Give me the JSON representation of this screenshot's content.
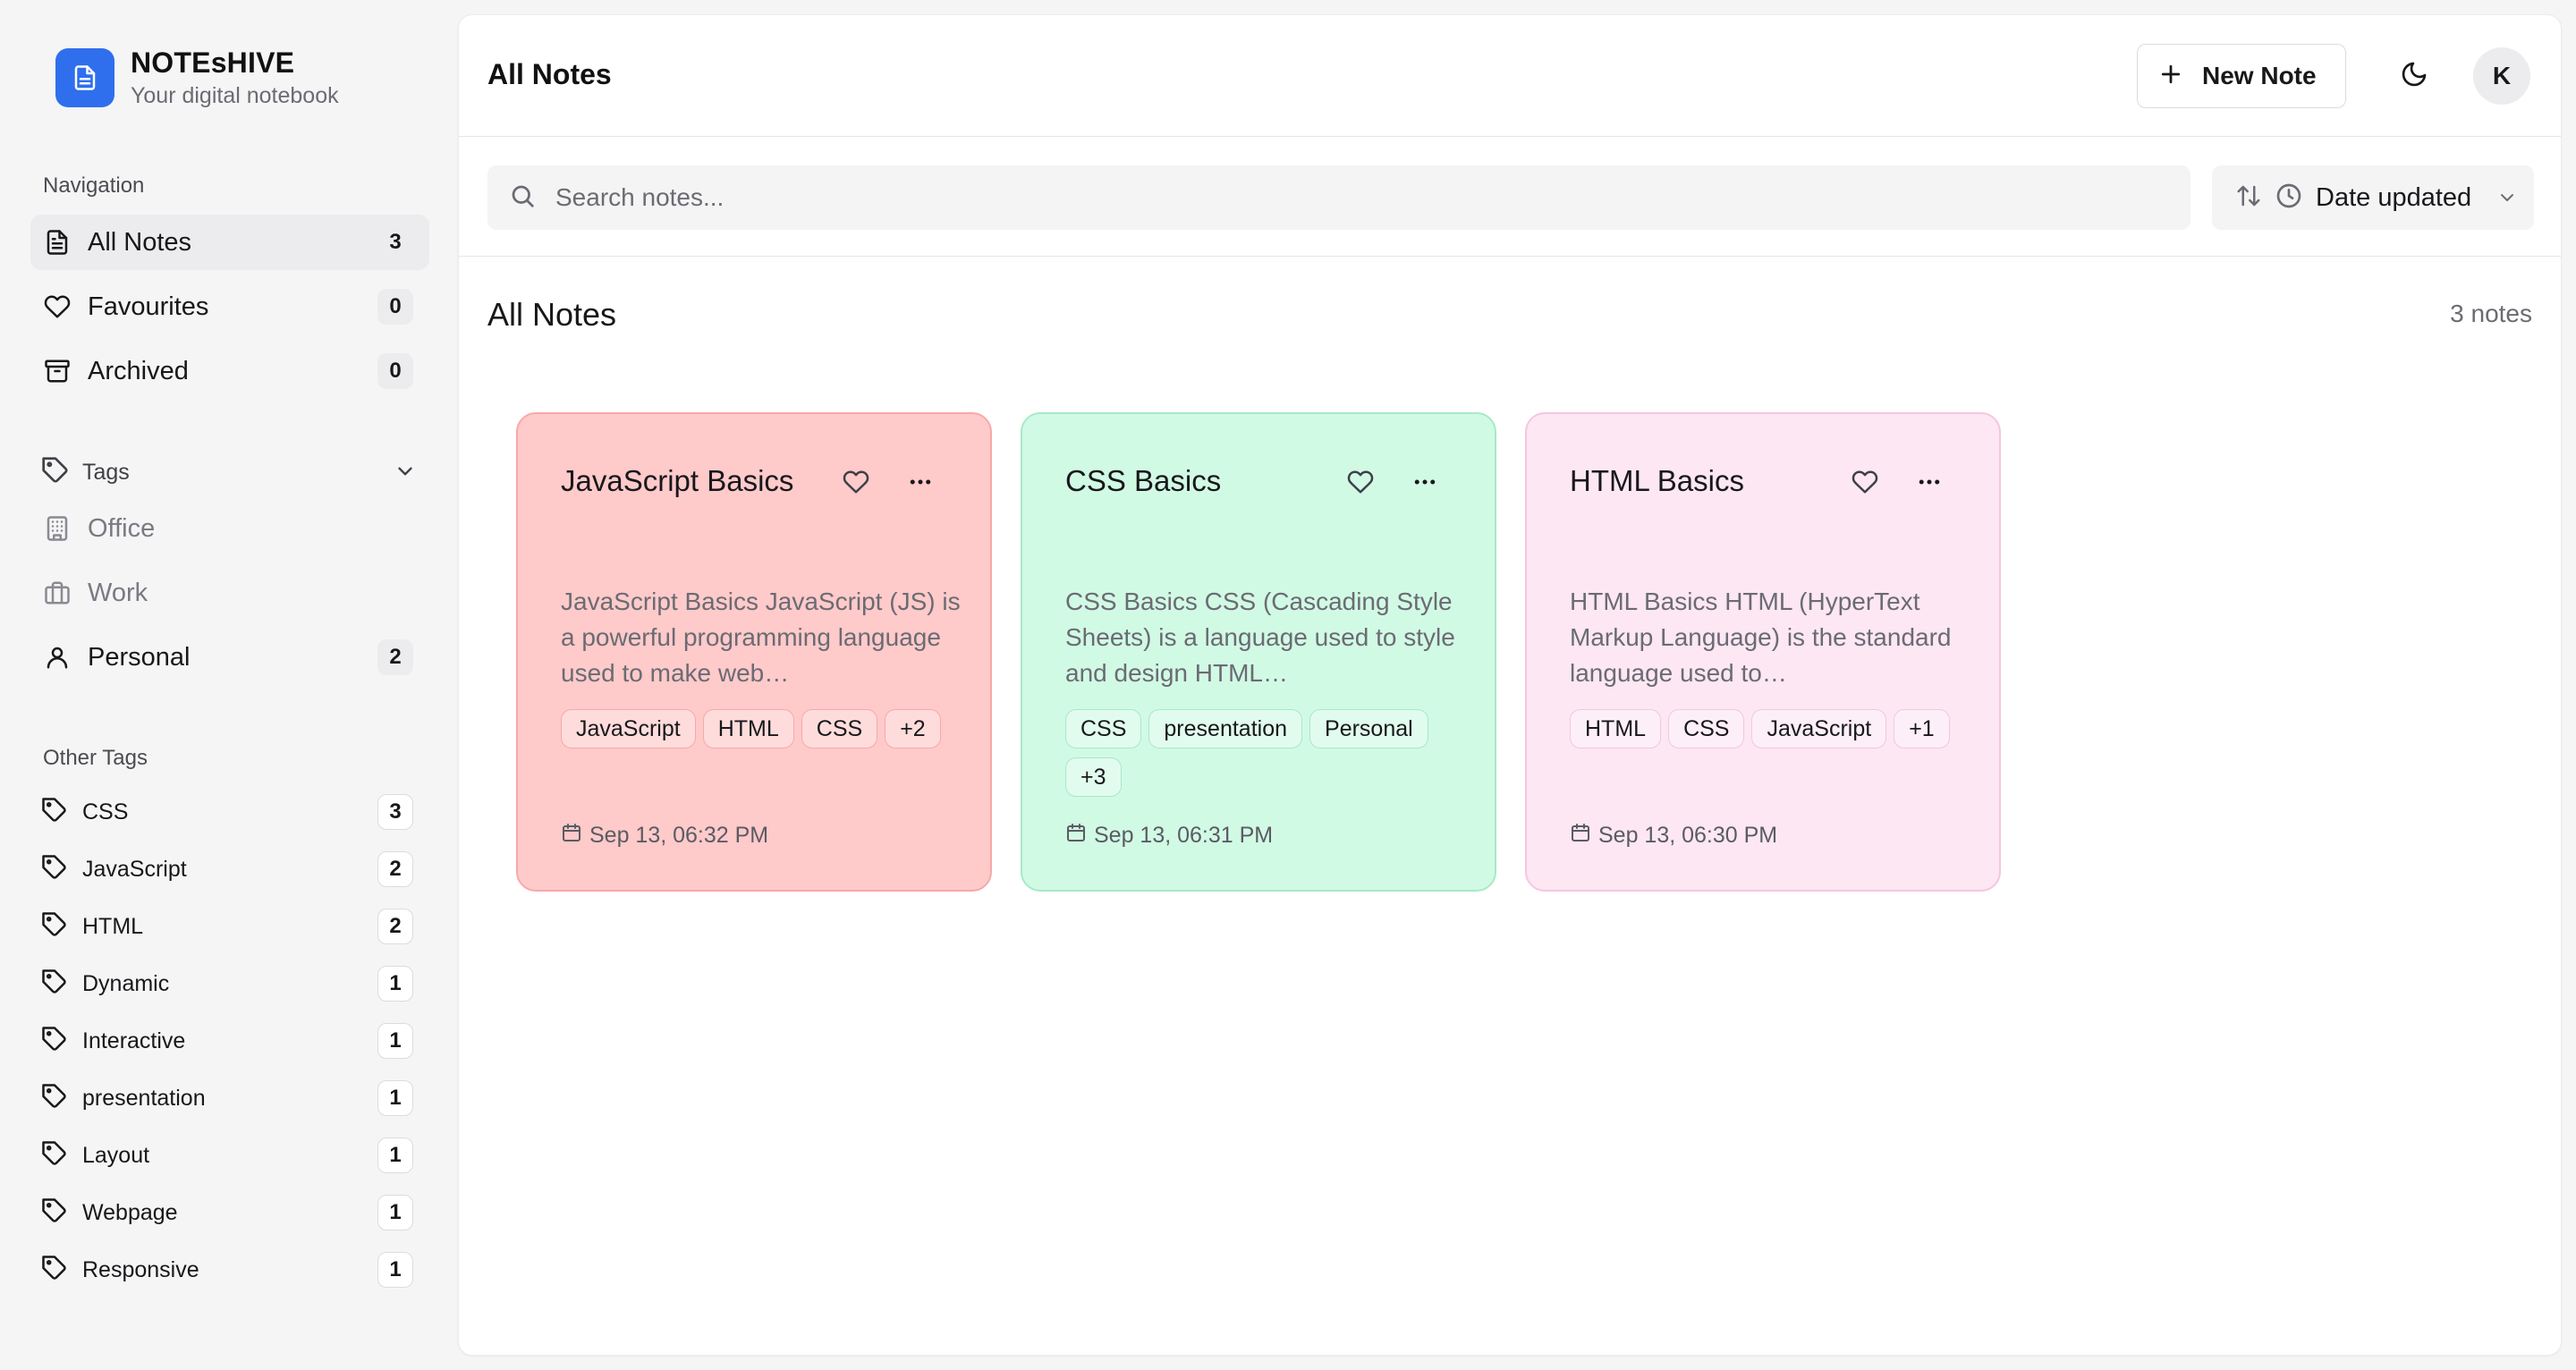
{
  "app": {
    "name": "NOTEsHIVE",
    "tagline": "Your digital notebook"
  },
  "sidebar": {
    "nav_label": "Navigation",
    "nav_items": [
      {
        "label": "All Notes",
        "count": "3",
        "icon": "file-text-icon",
        "active": true
      },
      {
        "label": "Favourites",
        "count": "0",
        "icon": "heart-icon",
        "active": false
      },
      {
        "label": "Archived",
        "count": "0",
        "icon": "archive-icon",
        "active": false
      }
    ],
    "tags_label": "Tags",
    "tag_groups": [
      {
        "label": "Office",
        "count": "",
        "icon": "building-icon"
      },
      {
        "label": "Work",
        "count": "",
        "icon": "briefcase-icon"
      },
      {
        "label": "Personal",
        "count": "2",
        "icon": "user-icon"
      }
    ],
    "other_tags_label": "Other Tags",
    "other_tags": [
      {
        "label": "CSS",
        "count": "3"
      },
      {
        "label": "JavaScript",
        "count": "2"
      },
      {
        "label": "HTML",
        "count": "2"
      },
      {
        "label": "Dynamic",
        "count": "1"
      },
      {
        "label": "Interactive",
        "count": "1"
      },
      {
        "label": "presentation",
        "count": "1"
      },
      {
        "label": "Layout",
        "count": "1"
      },
      {
        "label": "Webpage",
        "count": "1"
      },
      {
        "label": "Responsive",
        "count": "1"
      }
    ]
  },
  "header": {
    "title": "All Notes",
    "new_note_label": "New Note",
    "avatar_initial": "K"
  },
  "search": {
    "placeholder": "Search notes...",
    "value": ""
  },
  "sort": {
    "label": "Date updated"
  },
  "content": {
    "section_title": "All Notes",
    "notes_count": "3 notes"
  },
  "notes": [
    {
      "title": "JavaScript Basics",
      "body": "JavaScript Basics JavaScript (JS) is a powerful programming language used to make web…",
      "tags": [
        "JavaScript",
        "HTML",
        "CSS",
        "+2"
      ],
      "date": "Sep 13, 06:32 PM",
      "bg": "#fecaca",
      "border": "#f9a8a8"
    },
    {
      "title": "CSS Basics",
      "body": "CSS Basics CSS (Cascading Style Sheets) is a language used to style and design HTML…",
      "tags": [
        "CSS",
        "presentation",
        "Personal",
        "+3"
      ],
      "date": "Sep 13, 06:31 PM",
      "bg": "#d1fae5",
      "border": "#a7e9c9"
    },
    {
      "title": "HTML Basics",
      "body": "HTML Basics HTML (HyperText Markup Language) is the standard language used to…",
      "tags": [
        "HTML",
        "CSS",
        "JavaScript",
        "+1"
      ],
      "date": "Sep 13, 06:30 PM",
      "bg": "#fce7f3",
      "border": "#f5c6e0"
    }
  ],
  "colors": {
    "brand": "#2f6fed",
    "sidebar_bg": "#f5f5f6",
    "main_bg": "#ffffff"
  }
}
